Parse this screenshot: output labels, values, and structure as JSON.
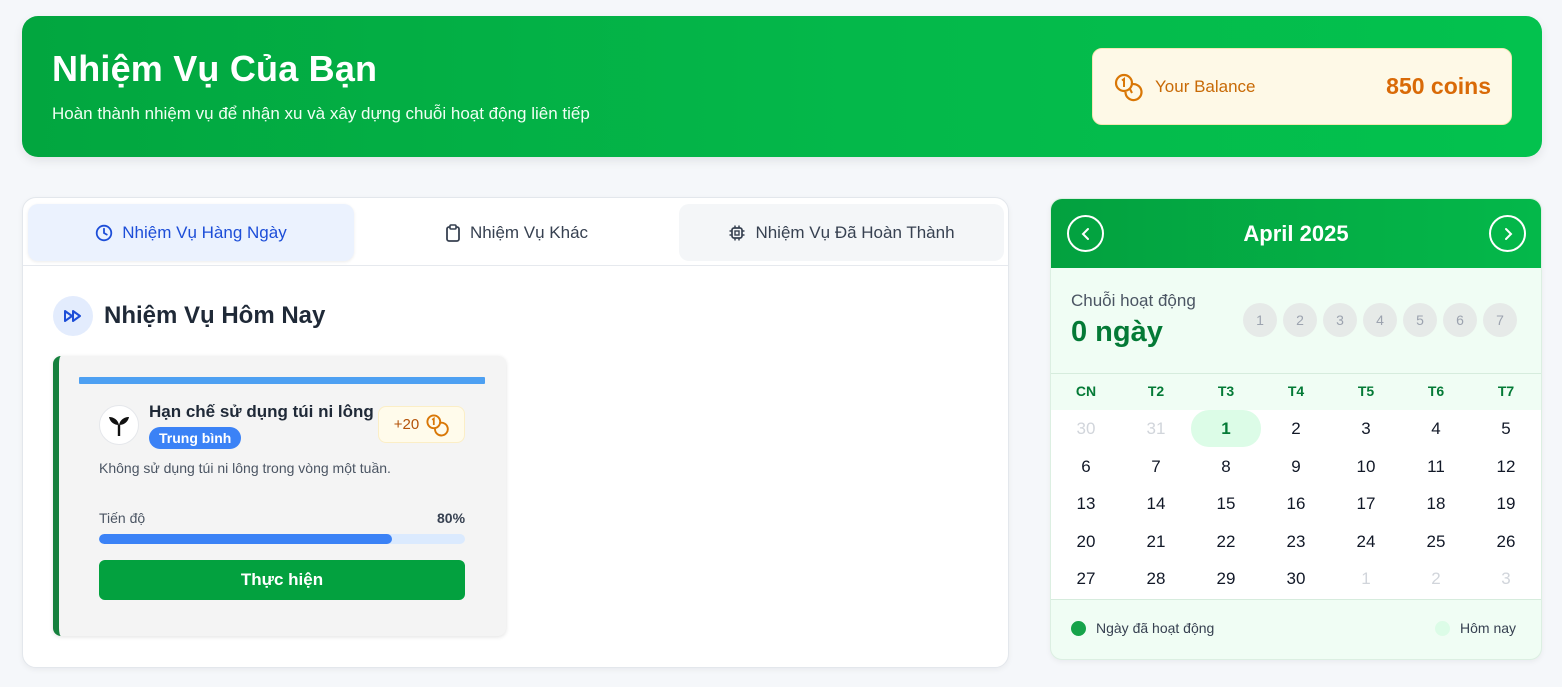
{
  "header": {
    "title": "Nhiệm Vụ Của Bạn",
    "subtitle": "Hoàn thành nhiệm vụ để nhận xu và xây dựng chuỗi hoạt động liên tiếp",
    "balance_label": "Your Balance",
    "balance_value": "850 coins"
  },
  "tabs": [
    {
      "label": "Nhiệm Vụ Hàng Ngày",
      "icon": "clock-icon",
      "active": true
    },
    {
      "label": "Nhiệm Vụ Khác",
      "icon": "clipboard-icon",
      "active": false
    },
    {
      "label": "Nhiệm Vụ Đã Hoàn Thành",
      "icon": "chip-icon",
      "active": false
    }
  ],
  "section": {
    "title": "Nhiệm Vụ Hôm Nay",
    "icon": "fast-forward-icon"
  },
  "task": {
    "name": "Hạn chế sử dụng túi ni lông",
    "difficulty": "Trung bình",
    "reward": "+20",
    "description": "Không sử dụng túi ni lông trong vòng một tuần.",
    "progress_label": "Tiến độ",
    "progress_text": "80%",
    "progress": 0.8,
    "action_label": "Thực hiện",
    "icon": "sprout-icon"
  },
  "calendar": {
    "title": "April 2025",
    "streak_label": "Chuỗi hoạt động",
    "streak_value": "0 ngày",
    "streak_days": [
      "1",
      "2",
      "3",
      "4",
      "5",
      "6",
      "7"
    ],
    "weekdays": [
      "CN",
      "T2",
      "T3",
      "T4",
      "T5",
      "T6",
      "T7"
    ],
    "weeks": [
      [
        "30",
        "31",
        "1",
        "2",
        "3",
        "4",
        "5"
      ],
      [
        "6",
        "7",
        "8",
        "9",
        "10",
        "11",
        "12"
      ],
      [
        "13",
        "14",
        "15",
        "16",
        "17",
        "18",
        "19"
      ],
      [
        "20",
        "21",
        "22",
        "23",
        "24",
        "25",
        "26"
      ],
      [
        "27",
        "28",
        "29",
        "30",
        "1",
        "2",
        "3"
      ]
    ],
    "today": "1",
    "legend_active": "Ngày đã hoạt động",
    "legend_today": "Hôm nay",
    "colors": {
      "active": "#16a34a",
      "today": "#dcfce7"
    }
  }
}
